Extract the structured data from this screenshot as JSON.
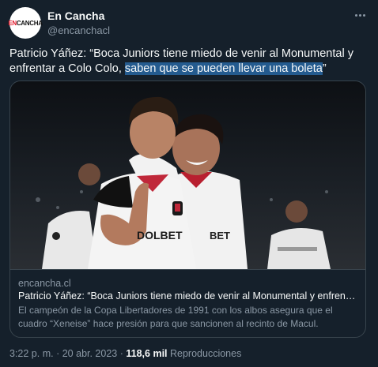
{
  "author": {
    "display_name": "En Cancha",
    "handle": "@encanchacl",
    "avatar_text_red": "EN",
    "avatar_text_dark": "CANCHA"
  },
  "tweet": {
    "text_plain": "Patricio Yáñez: “Boca Juniors tiene miedo de venir al Monumental y enfrentar a Colo Colo, ",
    "text_highlighted": "saben que se pueden llevar una boleta",
    "text_end": "”"
  },
  "card": {
    "domain": "encancha.cl",
    "title": "Patricio Yáñez: “Boca Juniors tiene miedo de venir al Monumental y enfrentar a Colo Colo",
    "description": "El campeón de la Copa Libertadores de 1991 con los albos asegura que el cuadro “Xeneise” hace presión para que sancionen al recinto de Macul.",
    "jersey_text_left": "DOLBET",
    "jersey_text_right": "BET"
  },
  "meta": {
    "time": "3:22 p. m.",
    "separator": "·",
    "date": "20 abr. 2023",
    "views_count": "118,6 mil",
    "views_label": "Reproducciones"
  },
  "colors": {
    "background": "#15202b",
    "highlight": "#245b8f",
    "brand_red": "#e3192b"
  },
  "icons": {
    "more": "more-horizontal-icon"
  }
}
